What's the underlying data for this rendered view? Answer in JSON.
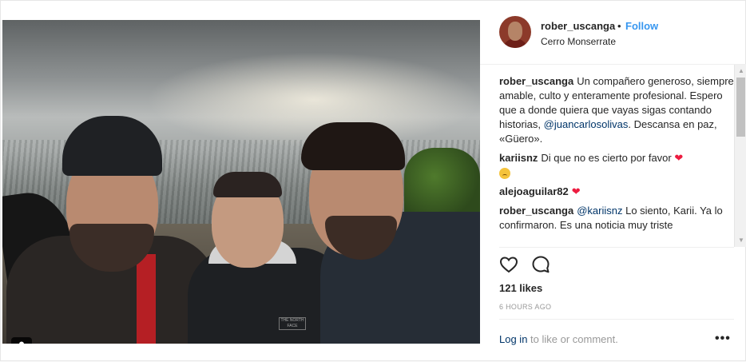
{
  "header": {
    "username": "rober_uscanga",
    "separator": "•",
    "follow_label": "Follow",
    "location": "Cerro Monserrate"
  },
  "comments": [
    {
      "user": "rober_uscanga",
      "text_before": "Un compañero generoso, siempre amable, culto y enteramente profesional. Espero que a donde quiera que vayas sigas contando historias,",
      "mention": "@juancarlosolivas",
      "text_after": ". Descansa en paz, «Güero»."
    },
    {
      "user": "kariisnz",
      "text": "Di que no es cierto por favor",
      "emoji_1": "red-heart-icon",
      "emoji_2": "sad-face-icon"
    },
    {
      "user": "alejoaguilar82",
      "emoji": "red-heart-icon"
    },
    {
      "user": "rober_uscanga",
      "mention": "@kariisnz",
      "text": "Lo siento, Karii. Ya lo confirmaron. Es una noticia muy triste"
    }
  ],
  "actions": {
    "like_icon": "heart-outline-icon",
    "comment_icon": "comment-bubble-icon"
  },
  "likes": "121 likes",
  "timestamp": "6 HOURS AGO",
  "footer": {
    "login_link": "Log in",
    "login_text": " to like or comment.",
    "more_label": "•••"
  },
  "photo": {
    "user_tag_icon": "person-tag-icon",
    "jacket_logo": "THE NORTH FACE"
  },
  "colors": {
    "link_blue": "#3897f0",
    "mention_blue": "#003569",
    "heart_red": "#ed1c40",
    "muted_gray": "#999999"
  }
}
